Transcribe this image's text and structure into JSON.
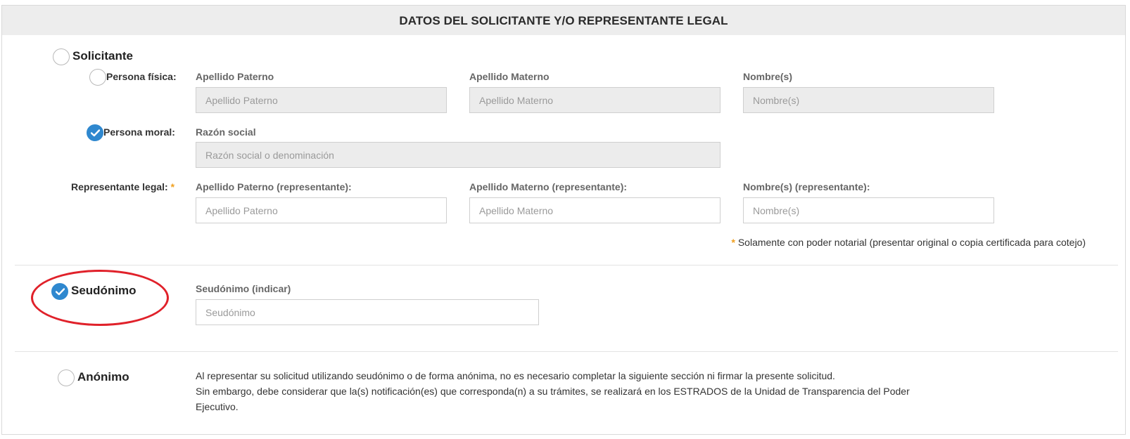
{
  "header": {
    "title": "DATOS DEL SOLICITANTE Y/O REPRESENTANTE LEGAL"
  },
  "solicitante": {
    "label": "Solicitante",
    "selected": false,
    "persona_fisica": {
      "label": "Persona física:",
      "selected": false,
      "fields": [
        {
          "label": "Apellido Paterno",
          "placeholder": "Apellido Paterno"
        },
        {
          "label": "Apellido Materno",
          "placeholder": "Apellido Materno"
        },
        {
          "label": "Nombre(s)",
          "placeholder": "Nombre(s)"
        }
      ]
    },
    "persona_moral": {
      "label": "Persona moral:",
      "selected": true,
      "field": {
        "label": "Razón social",
        "placeholder": "Razón social o denominación"
      }
    },
    "representante": {
      "label": "Representante legal:",
      "required_mark": "*",
      "fields": [
        {
          "label": "Apellido Paterno (representante):",
          "placeholder": "Apellido Paterno"
        },
        {
          "label": "Apellido Materno (representante):",
          "placeholder": "Apellido Materno"
        },
        {
          "label": "Nombre(s) (representante):",
          "placeholder": "Nombre(s)"
        }
      ],
      "note_mark": "*",
      "note": "Solamente con poder notarial (presentar original o copia certificada para cotejo)"
    }
  },
  "seudonimo": {
    "label": "Seudónimo",
    "selected": true,
    "field": {
      "label": "Seudónimo (indicar)",
      "placeholder": "Seudónimo"
    }
  },
  "anonimo": {
    "label": "Anónimo",
    "selected": false,
    "info_line1": "Al representar su solicitud utilizando seudónimo o de forma anónima, no es necesario completar la siguiente sección ni firmar la presente solicitud.",
    "info_line2": "Sin embargo, debe considerar que la(s) notificación(es) que corresponda(n) a su trámites, se realizará en los ESTRADOS de la Unidad de Transparencia del Poder",
    "info_line3": "Ejecutivo."
  },
  "colors": {
    "accent": "#2f88cf",
    "highlight": "#e0212a",
    "required": "#f0a020",
    "header_bg": "#ededed"
  },
  "icons": {
    "check": "check-icon"
  }
}
